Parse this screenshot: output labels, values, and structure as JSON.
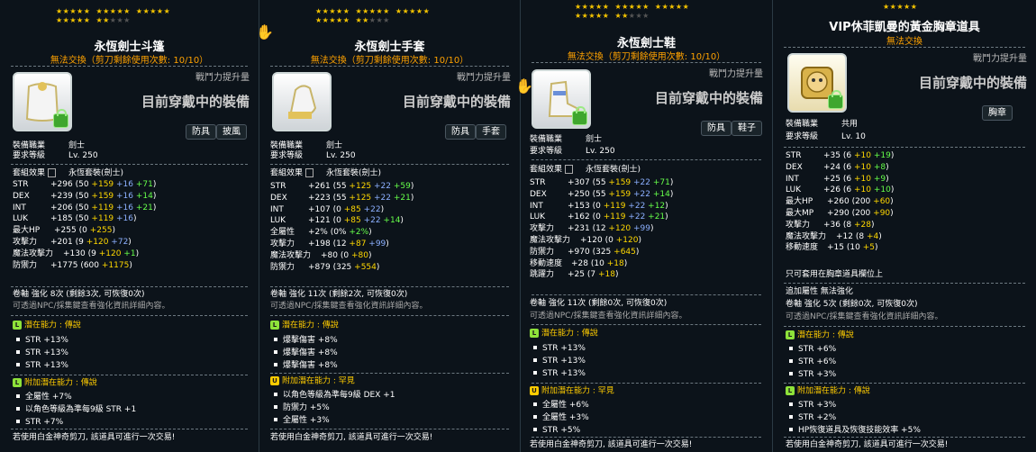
{
  "panels": [
    {
      "stars": {
        "filled": 17,
        "total": 20
      },
      "title": "永恆劍士斗篷",
      "subtitle": "無法交換（剪刀剩餘使用次數: 10/10）",
      "cp_label": "戰鬥力提升量",
      "equipped": "目前穿戴中的裝備",
      "tags": [
        "防具",
        "披風"
      ],
      "req_job_label": "裝備職業",
      "req_job": "劍士",
      "req_level_label": "要求等級",
      "req_level": "Lv. 250",
      "set_label": "套組效果",
      "set_name": "永恆套裝(劍士)",
      "stats": [
        {
          "k": "STR",
          "total": "+296",
          "parts": [
            [
              "(50 ",
              ""
            ],
            [
              "+159",
              "y"
            ],
            [
              " +16",
              "b"
            ],
            [
              " +71",
              "g2"
            ],
            [
              ")",
              ""
            ]
          ]
        },
        {
          "k": "DEX",
          "total": "+239",
          "parts": [
            [
              "(50 ",
              ""
            ],
            [
              "+159",
              "y"
            ],
            [
              " +16",
              "b"
            ],
            [
              " +14",
              "g2"
            ],
            [
              ")",
              ""
            ]
          ]
        },
        {
          "k": "INT",
          "total": "+206",
          "parts": [
            [
              "(50 ",
              ""
            ],
            [
              "+119",
              "y"
            ],
            [
              " +16",
              "b"
            ],
            [
              " +21",
              "g2"
            ],
            [
              ")",
              ""
            ]
          ]
        },
        {
          "k": "LUK",
          "total": "+185",
          "parts": [
            [
              "(50 ",
              ""
            ],
            [
              "+119",
              "y"
            ],
            [
              " +16",
              "b"
            ],
            [
              ")",
              ""
            ]
          ]
        },
        {
          "k": "最大HP",
          "total": "+255",
          "parts": [
            [
              "(0 ",
              ""
            ],
            [
              "+255",
              "y"
            ],
            [
              ")",
              ""
            ]
          ]
        },
        {
          "k": "攻擊力",
          "total": "+201",
          "parts": [
            [
              "(9 ",
              ""
            ],
            [
              "+120",
              "y"
            ],
            [
              " +72",
              "b"
            ],
            [
              ")",
              ""
            ]
          ]
        },
        {
          "k": "魔法攻擊力",
          "total": "+130",
          "parts": [
            [
              "(9 ",
              ""
            ],
            [
              "+120",
              "y"
            ],
            [
              " +1",
              "g2"
            ],
            [
              ")",
              ""
            ]
          ]
        },
        {
          "k": "防禦力",
          "total": "+1775",
          "parts": [
            [
              "(600 ",
              ""
            ],
            [
              "+1175",
              "y"
            ],
            [
              ")",
              ""
            ]
          ]
        }
      ],
      "enhance": "卷軸 強化 8次 (剩餘3次, 可恢復0次)",
      "hint": "可透過NPC/採集鍵查看強化資訊詳細內容。",
      "potential_title": "潛在能力 : 傳說",
      "potential": [
        "STR +13%",
        "STR +13%",
        "STR +13%"
      ],
      "bonus_title": "附加潛在能力 : 傳說",
      "bonus": [
        "全屬性 +7%",
        "以角色等級為準每9級 STR +1",
        "STR +7%"
      ],
      "footer": "若使用白金神奇剪刀, 該道具可進行一次交易!"
    },
    {
      "stars": {
        "filled": 17,
        "total": 20
      },
      "title": "永恆劍士手套",
      "subtitle": "無法交換（剪刀剩餘使用次數: 10/10）",
      "cp_label": "戰鬥力提升量",
      "equipped": "目前穿戴中的裝備",
      "tags": [
        "防具",
        "手套"
      ],
      "req_job_label": "裝備職業",
      "req_job": "劍士",
      "req_level_label": "要求等級",
      "req_level": "Lv. 250",
      "set_label": "套組效果",
      "set_name": "永恆套裝(劍士)",
      "stats": [
        {
          "k": "STR",
          "total": "+261",
          "parts": [
            [
              "(55 ",
              ""
            ],
            [
              "+125",
              "y"
            ],
            [
              " +22",
              "b"
            ],
            [
              " +59",
              "g2"
            ],
            [
              ")",
              ""
            ]
          ]
        },
        {
          "k": "DEX",
          "total": "+223",
          "parts": [
            [
              "(55 ",
              ""
            ],
            [
              "+125",
              "y"
            ],
            [
              " +22",
              "b"
            ],
            [
              " +21",
              "g2"
            ],
            [
              ")",
              ""
            ]
          ]
        },
        {
          "k": "INT",
          "total": "+107",
          "parts": [
            [
              "(0 ",
              ""
            ],
            [
              "+85",
              "y"
            ],
            [
              " +22",
              "b"
            ],
            [
              ")",
              ""
            ]
          ]
        },
        {
          "k": "LUK",
          "total": "+121",
          "parts": [
            [
              "(0 ",
              ""
            ],
            [
              "+85",
              "y"
            ],
            [
              " +22",
              "b"
            ],
            [
              " +14",
              "g2"
            ],
            [
              ")",
              ""
            ]
          ]
        },
        {
          "k": "全屬性",
          "total": "+2%",
          "parts": [
            [
              "(0% ",
              ""
            ],
            [
              "+2%",
              "g2"
            ],
            [
              ")",
              ""
            ]
          ]
        },
        {
          "k": "攻擊力",
          "total": "+198",
          "parts": [
            [
              "(12 ",
              ""
            ],
            [
              "+87",
              "y"
            ],
            [
              " +99",
              "b"
            ],
            [
              ")",
              ""
            ]
          ]
        },
        {
          "k": "魔法攻擊力",
          "total": "+80",
          "parts": [
            [
              "(0 ",
              ""
            ],
            [
              "+80",
              "y"
            ],
            [
              ")",
              ""
            ]
          ]
        },
        {
          "k": "防禦力",
          "total": "+879",
          "parts": [
            [
              "(325 ",
              ""
            ],
            [
              "+554",
              "y"
            ],
            [
              ")",
              ""
            ]
          ]
        }
      ],
      "enhance": "卷軸 強化 11次 (剩餘2次, 可恢復0次)",
      "hint": "可透過NPC/採集鍵查看強化資訊詳細內容。",
      "potential_title": "潛在能力 : 傳說",
      "potential": [
        "爆擊傷害 +8%",
        "爆擊傷害 +8%",
        "爆擊傷害 +8%"
      ],
      "bonus_title": "附加潛在能力 : 罕見",
      "bonus": [
        "以角色等級為準每9級 DEX +1",
        "防禦力 +5%",
        "全屬性 +3%"
      ],
      "footer": "若使用白金神奇剪刀, 該道具可進行一次交易!"
    },
    {
      "stars": {
        "filled": 17,
        "total": 20
      },
      "title": "永恆劍士鞋",
      "subtitle": "無法交換（剪刀剩餘使用次數: 10/10）",
      "cp_label": "戰鬥力提升量",
      "equipped": "目前穿戴中的裝備",
      "tags": [
        "防具",
        "鞋子"
      ],
      "req_job_label": "裝備職業",
      "req_job": "劍士",
      "req_level_label": "要求等級",
      "req_level": "Lv. 250",
      "set_label": "套組效果",
      "set_name": "永恆套裝(劍士)",
      "stats": [
        {
          "k": "STR",
          "total": "+307",
          "parts": [
            [
              "(55 ",
              ""
            ],
            [
              "+159",
              "y"
            ],
            [
              " +22",
              "b"
            ],
            [
              " +71",
              "g2"
            ],
            [
              ")",
              ""
            ]
          ]
        },
        {
          "k": "DEX",
          "total": "+250",
          "parts": [
            [
              "(55 ",
              ""
            ],
            [
              "+159",
              "y"
            ],
            [
              " +22",
              "b"
            ],
            [
              " +14",
              "g2"
            ],
            [
              ")",
              ""
            ]
          ]
        },
        {
          "k": "INT",
          "total": "+153",
          "parts": [
            [
              "(0 ",
              ""
            ],
            [
              "+119",
              "y"
            ],
            [
              " +22",
              "b"
            ],
            [
              " +12",
              "g2"
            ],
            [
              ")",
              ""
            ]
          ]
        },
        {
          "k": "LUK",
          "total": "+162",
          "parts": [
            [
              "(0 ",
              ""
            ],
            [
              "+119",
              "y"
            ],
            [
              " +22",
              "b"
            ],
            [
              " +21",
              "g2"
            ],
            [
              ")",
              ""
            ]
          ]
        },
        {
          "k": "攻擊力",
          "total": "+231",
          "parts": [
            [
              "(12 ",
              ""
            ],
            [
              "+120",
              "y"
            ],
            [
              " +99",
              "b"
            ],
            [
              ")",
              ""
            ]
          ]
        },
        {
          "k": "魔法攻擊力",
          "total": "+120",
          "parts": [
            [
              "(0 ",
              ""
            ],
            [
              "+120",
              "y"
            ],
            [
              ")",
              ""
            ]
          ]
        },
        {
          "k": "防禦力",
          "total": "+970",
          "parts": [
            [
              "(325 ",
              ""
            ],
            [
              "+645",
              "y"
            ],
            [
              ")",
              ""
            ]
          ]
        },
        {
          "k": "移動速度",
          "total": "+28",
          "parts": [
            [
              "(10 ",
              ""
            ],
            [
              "+18",
              "y"
            ],
            [
              ")",
              ""
            ]
          ]
        },
        {
          "k": "跳躍力",
          "total": "+25",
          "parts": [
            [
              "(7 ",
              ""
            ],
            [
              "+18",
              "y"
            ],
            [
              ")",
              ""
            ]
          ]
        }
      ],
      "enhance": "卷軸 強化 11次 (剩餘0次, 可恢復0次)",
      "hint": "可透過NPC/採集鍵查看強化資訊詳細內容。",
      "potential_title": "潛在能力 : 傳說",
      "potential": [
        "STR +13%",
        "STR +13%",
        "STR +13%"
      ],
      "bonus_title": "附加潛在能力 : 罕見",
      "bonus": [
        "全屬性 +6%",
        "全屬性 +3%",
        "STR +5%"
      ],
      "footer": "若使用白金神奇剪刀, 該道具可進行一次交易!"
    },
    {
      "stars": {
        "filled": 5,
        "total": 5
      },
      "title": "VIP休菲凱曼的黃金胸章道具",
      "subtitle": "無法交換",
      "cp_label": "戰鬥力提升量",
      "equipped": "目前穿戴中的裝備",
      "tags": [
        "胸章"
      ],
      "req_job_label": "裝備職業",
      "req_job": "共用",
      "req_level_label": "要求等級",
      "req_level": "Lv. 10",
      "stats": [
        {
          "k": "STR",
          "total": "+35",
          "parts": [
            [
              "(6 ",
              ""
            ],
            [
              "+10",
              "y"
            ],
            [
              " +19",
              "g2"
            ],
            [
              ")",
              ""
            ]
          ]
        },
        {
          "k": "DEX",
          "total": "+24",
          "parts": [
            [
              "(6 ",
              ""
            ],
            [
              "+10",
              "y"
            ],
            [
              " +8",
              "g2"
            ],
            [
              ")",
              ""
            ]
          ]
        },
        {
          "k": "INT",
          "total": "+25",
          "parts": [
            [
              "(6 ",
              ""
            ],
            [
              "+10",
              "y"
            ],
            [
              " +9",
              "g2"
            ],
            [
              ")",
              ""
            ]
          ]
        },
        {
          "k": "LUK",
          "total": "+26",
          "parts": [
            [
              "(6 ",
              ""
            ],
            [
              "+10",
              "y"
            ],
            [
              " +10",
              "g2"
            ],
            [
              ")",
              ""
            ]
          ]
        },
        {
          "k": "最大HP",
          "total": "+260",
          "parts": [
            [
              "(200 ",
              ""
            ],
            [
              "+60",
              "y"
            ],
            [
              ")",
              ""
            ]
          ]
        },
        {
          "k": "最大MP",
          "total": "+290",
          "parts": [
            [
              "(200 ",
              ""
            ],
            [
              "+90",
              "y"
            ],
            [
              ")",
              ""
            ]
          ]
        },
        {
          "k": "攻擊力",
          "total": "+36",
          "parts": [
            [
              "(8 ",
              ""
            ],
            [
              "+28",
              "y"
            ],
            [
              ")",
              ""
            ]
          ]
        },
        {
          "k": "魔法攻擊力",
          "total": "+12",
          "parts": [
            [
              "(8 ",
              ""
            ],
            [
              "+4",
              "y"
            ],
            [
              ")",
              ""
            ]
          ]
        },
        {
          "k": "移動速度",
          "total": "+15",
          "parts": [
            [
              "(10 ",
              ""
            ],
            [
              "+5",
              "y"
            ],
            [
              ")",
              ""
            ]
          ]
        }
      ],
      "only_equip": "只可套用在胸章道具欄位上",
      "extra": "追加屬性 無法強化",
      "enhance": "卷軸 強化 5次 (剩餘0次, 可恢復0次)",
      "hint": "可透過NPC/採集鍵查看強化資訊詳細內容。",
      "potential_title": "潛在能力 : 傳說",
      "potential": [
        "STR +6%",
        "STR +6%",
        "STR +3%"
      ],
      "bonus_title": "附加潛在能力 : 傳說",
      "bonus": [
        "STR +3%",
        "STR +2%",
        "HP恢復道具及恢復技能效率 +5%"
      ],
      "footer": "若使用白金神奇剪刀, 該道具可進行一次交易!"
    }
  ]
}
